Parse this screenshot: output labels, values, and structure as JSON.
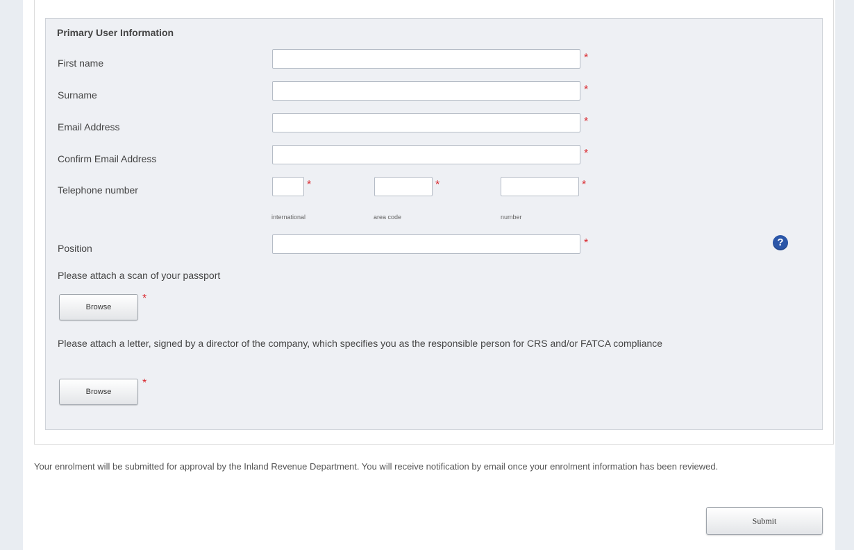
{
  "form": {
    "section_title": "Primary User Information",
    "required_marker": "*",
    "fields": {
      "first_name": {
        "label": "First name",
        "value": ""
      },
      "surname": {
        "label": "Surname",
        "value": ""
      },
      "email": {
        "label": "Email Address",
        "value": ""
      },
      "confirm_email": {
        "label": "Confirm Email Address",
        "value": ""
      },
      "telephone": {
        "label": "Telephone number",
        "international_label": "international",
        "area_code_label": "area code",
        "number_label": "number"
      },
      "position": {
        "label": "Position",
        "value": ""
      }
    },
    "help_icon": "question-mark-icon",
    "passport": {
      "label": "Please attach a scan of your passport",
      "button_label": "Browse"
    },
    "letter": {
      "label": "Please attach a letter, signed by a director of the company, which specifies you as the responsible person for CRS and/or FATCA compliance",
      "button_label": "Browse"
    }
  },
  "notice": "Your enrolment will be submitted for approval by the Inland Revenue Department. You will receive notification by email once your enrolment information has been reviewed.",
  "submit_label": "Submit",
  "colors": {
    "required": "#d9262c",
    "help_icon": "#2b56a8",
    "panel_background": "#eef0f4"
  }
}
